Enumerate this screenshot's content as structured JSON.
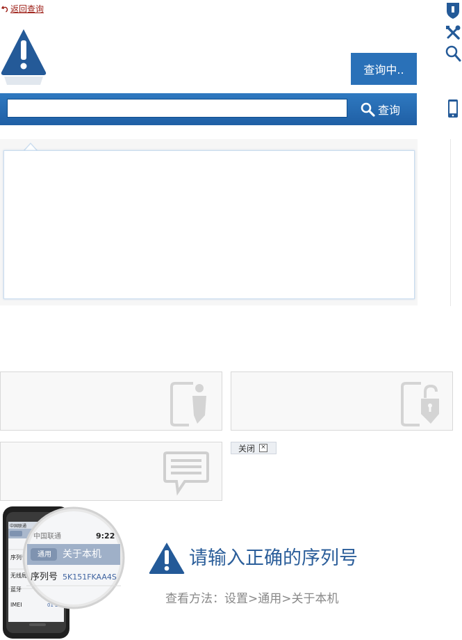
{
  "nav": {
    "back_label": "返回查询"
  },
  "status_button": {
    "label": "查询中.."
  },
  "search": {
    "placeholder": "",
    "button_label": "查询"
  },
  "sidebar_icons": [
    "shield-icon",
    "tools-icon",
    "search-icon",
    "mobile-phone-icon"
  ],
  "cards": [
    {
      "icon": "person-tablet-icon"
    },
    {
      "icon": "lock-tablet-icon"
    },
    {
      "icon": "message-bubble-icon"
    }
  ],
  "close_tag": {
    "label": "关闭",
    "close_glyph": "×"
  },
  "phone_illustration": {
    "carrier": "中国联通",
    "time": "9:22",
    "back_label": "通用",
    "nav_title": "关于本机",
    "serial_label": "序列号",
    "serial_value": "5K151FKAA4S",
    "rows": [
      "序列号",
      "无线局",
      "蓝牙",
      "IMEI"
    ],
    "imei_value": "01 2"
  },
  "notice": {
    "title": "请输入正确的序列号",
    "hint": "查看方法：设置>通用>关于本机"
  },
  "colors": {
    "primary": "#2a71b8",
    "title_blue": "#2b5e9a",
    "link_red": "#9b1a12"
  }
}
